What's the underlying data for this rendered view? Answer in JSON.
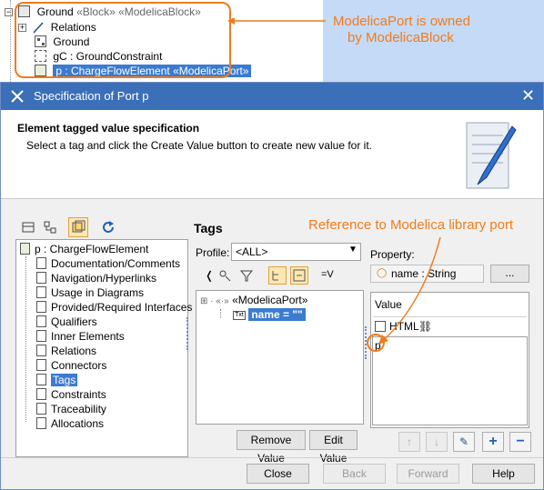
{
  "top_tree": {
    "root_label": "Ground",
    "root_stereo": "«Block» «ModelicaBlock»",
    "items": [
      {
        "label": "Relations"
      },
      {
        "label": "Ground"
      },
      {
        "label": "gC : GroundConstraint"
      },
      {
        "label": "p : ChargeFlowElement «ModelicaPort»"
      }
    ]
  },
  "annotations": {
    "owned_line1": "ModelicaPort is owned",
    "owned_line2": "by ModelicaBlock",
    "reference": "Reference to Modelica library port"
  },
  "dialog": {
    "title": "Specification of Port p",
    "header_title": "Element tagged value specification",
    "header_desc": "Select a tag and click the Create Value button to create new value for it.",
    "nav_root": "p : ChargeFlowElement",
    "nav_items": [
      "Documentation/Comments",
      "Navigation/Hyperlinks",
      "Usage in Diagrams",
      "Provided/Required Interfaces",
      "Qualifiers",
      "Inner Elements",
      "Relations",
      "Connectors",
      "Tags",
      "Constraints",
      "Traceability",
      "Allocations"
    ],
    "nav_selected": "Tags",
    "section_title": "Tags",
    "profile_label": "Profile:",
    "profile_value": "<ALL>",
    "property_label": "Property:",
    "property_value": "name : String",
    "ellipsis": "...",
    "tag_tree_stereo": "«ModelicaPort»",
    "tag_tree_item": "name = \"\"",
    "value_header": "Value",
    "html_label": "HTML",
    "value_text": "p",
    "remove_value": "Remove Value",
    "edit_value": "Edit Value",
    "close": "Close",
    "back": "Back",
    "forward": "Forward",
    "help": "Help",
    "eq_v": "=V"
  },
  "colors": {
    "accent_orange": "#f07c1c",
    "selection_blue": "#3b7bd0",
    "titlebar_blue": "#3b6fb8"
  }
}
